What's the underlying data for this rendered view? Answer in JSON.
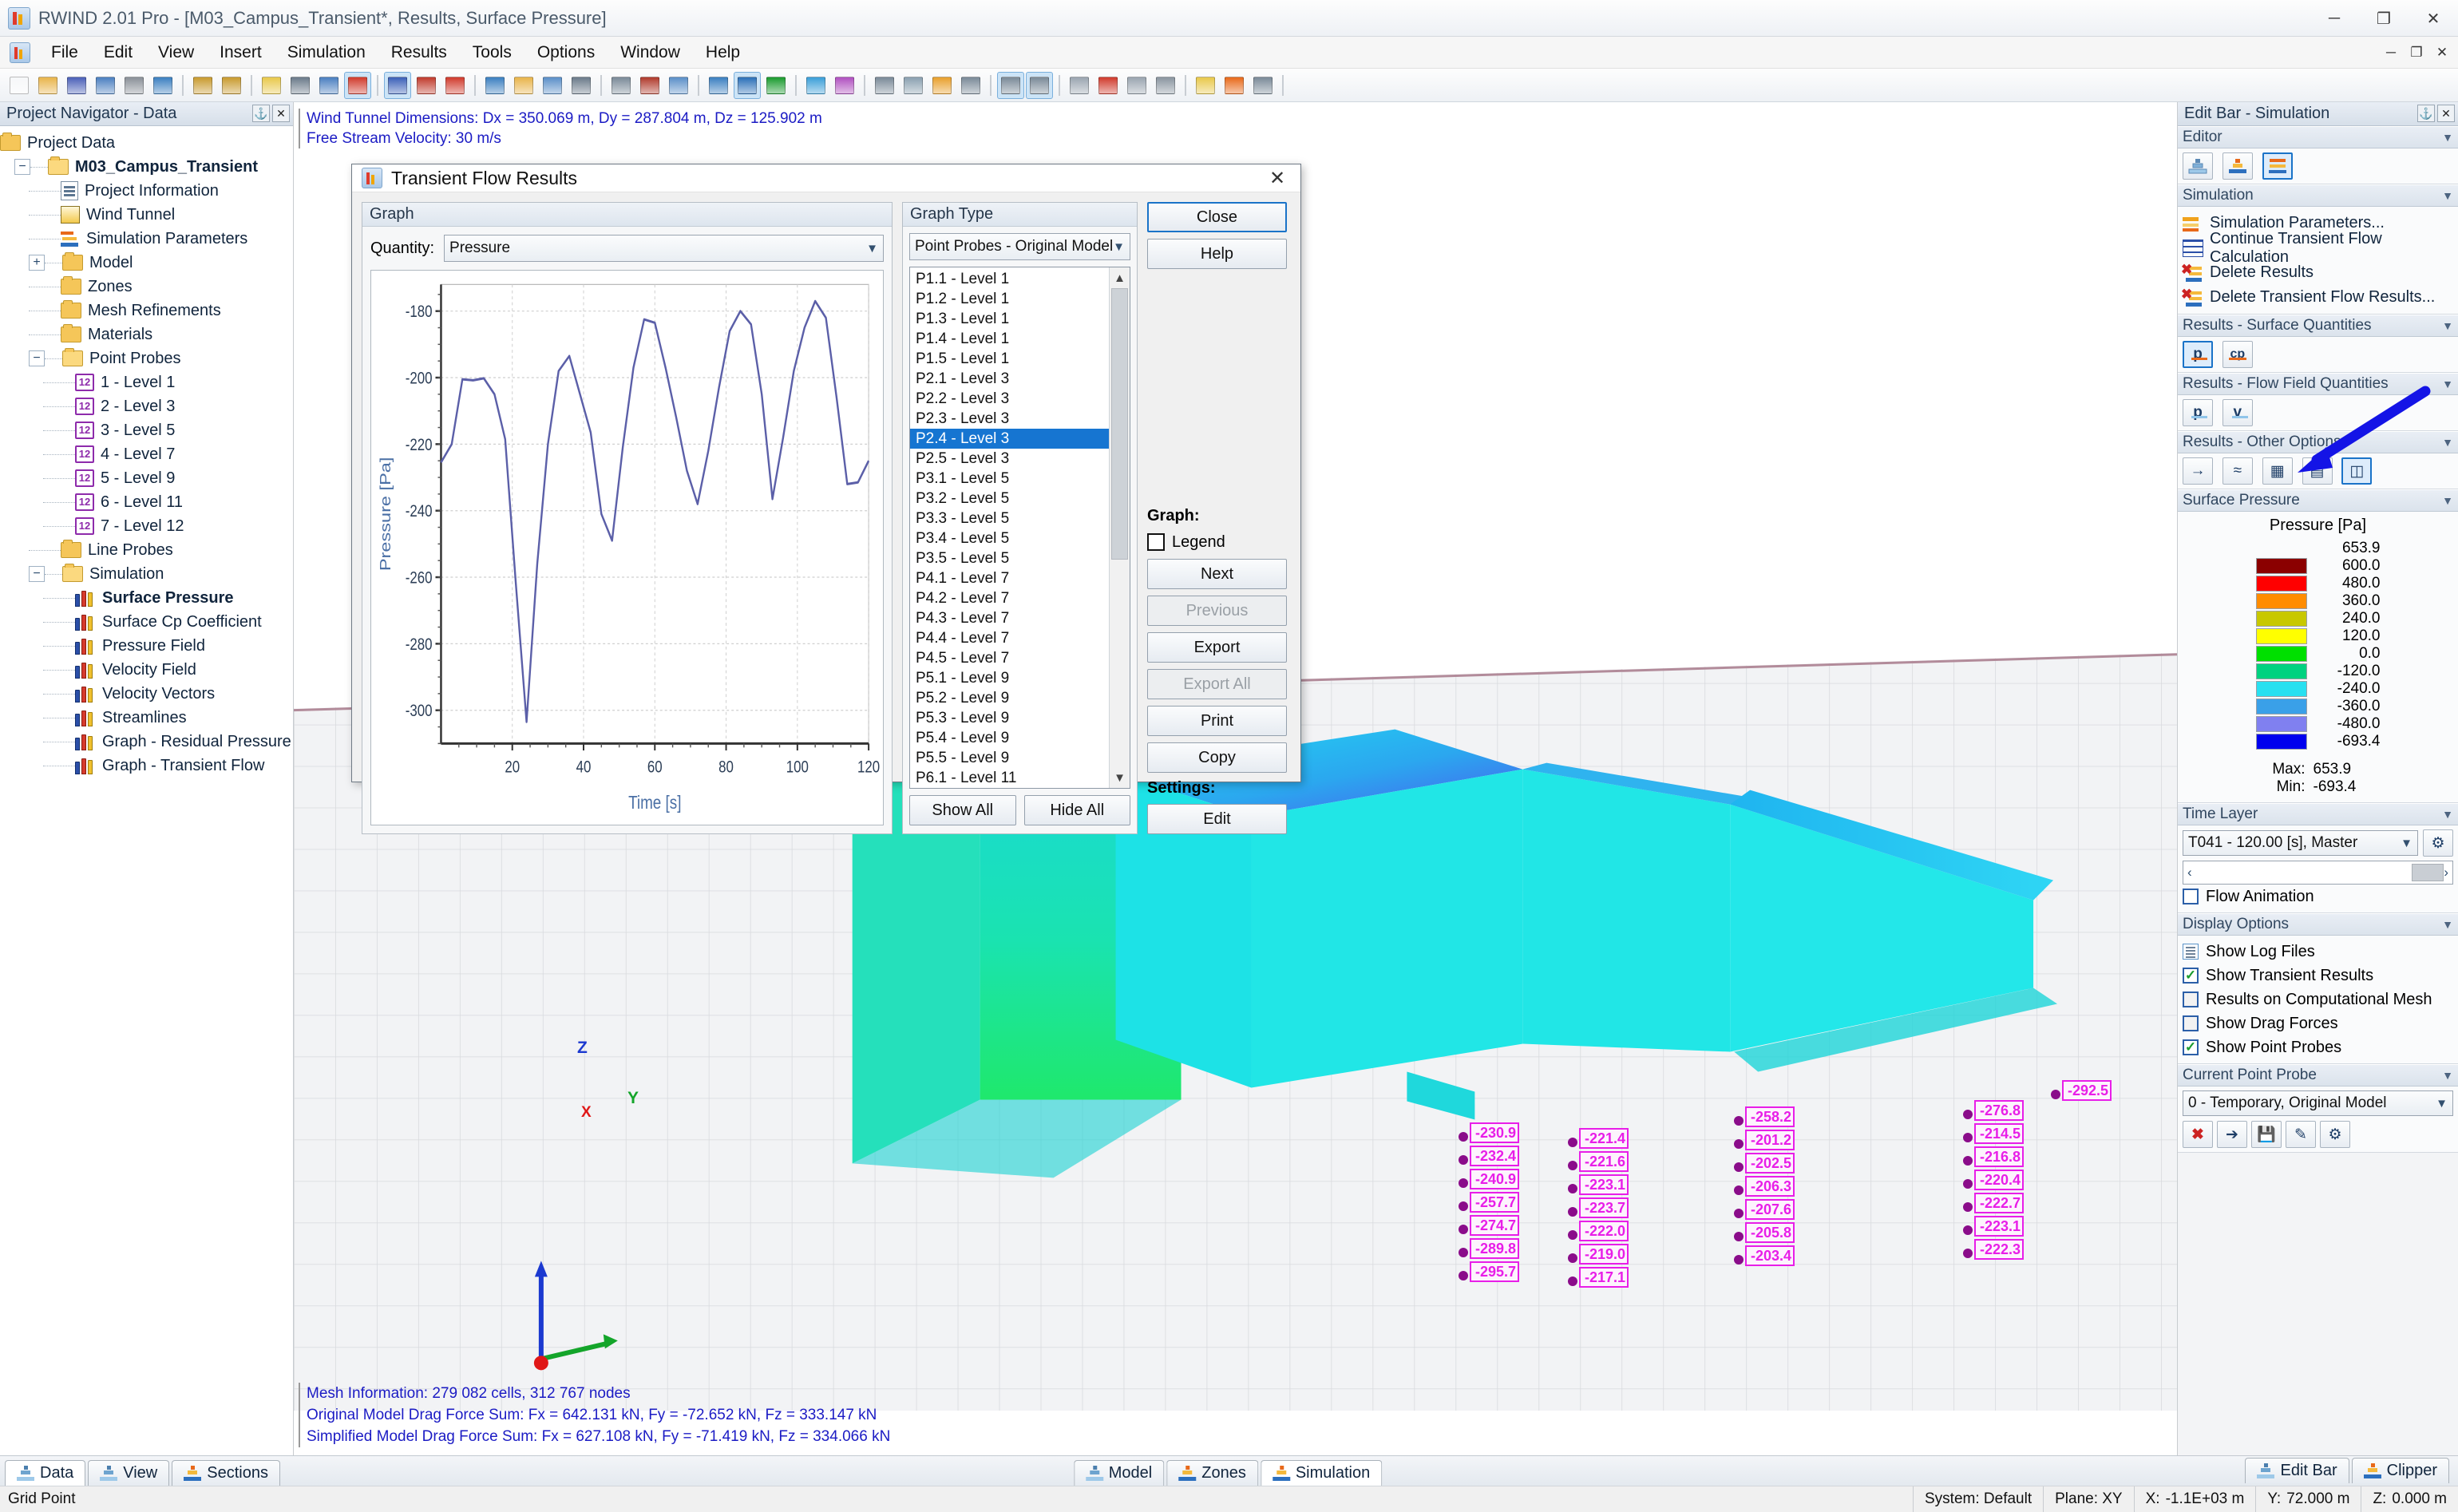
{
  "window": {
    "title": "RWIND 2.01 Pro - [M03_Campus_Transient*, Results, Surface Pressure]",
    "minimize": "─",
    "maximize": "❐",
    "close": "✕"
  },
  "menu": {
    "items": [
      "File",
      "Edit",
      "View",
      "Insert",
      "Simulation",
      "Results",
      "Tools",
      "Options",
      "Window",
      "Help"
    ],
    "mdi": [
      "─",
      "❐",
      "✕"
    ]
  },
  "navigator": {
    "title": "Project Navigator - Data",
    "pin": "⚓",
    "close": "✕",
    "items": [
      {
        "label": "Project Data",
        "icon": "folder-icon",
        "depth": 0,
        "expander": "",
        "bold": false
      },
      {
        "label": "M03_Campus_Transient",
        "icon": "folder-open-icon",
        "depth": 1,
        "expander": "−",
        "bold": true
      },
      {
        "label": "Project Information",
        "icon": "document-icon",
        "depth": 2,
        "expander": "",
        "bold": false
      },
      {
        "label": "Wind Tunnel",
        "icon": "cube-icon",
        "depth": 2,
        "expander": "",
        "bold": false
      },
      {
        "label": "Simulation Parameters",
        "icon": "simulation-parameters-icon",
        "depth": 2,
        "expander": "",
        "bold": false
      },
      {
        "label": "Model",
        "icon": "folder-icon",
        "depth": 2,
        "expander": "+",
        "bold": false
      },
      {
        "label": "Zones",
        "icon": "folder-icon",
        "depth": 2,
        "expander": "",
        "bold": false
      },
      {
        "label": "Mesh Refinements",
        "icon": "folder-icon",
        "depth": 2,
        "expander": "",
        "bold": false
      },
      {
        "label": "Materials",
        "icon": "folder-icon",
        "depth": 2,
        "expander": "",
        "bold": false
      },
      {
        "label": "Point Probes",
        "icon": "folder-open-icon",
        "depth": 2,
        "expander": "−",
        "bold": false
      },
      {
        "label": "1 - Level 1",
        "icon": "point-probe-icon",
        "depth": 3,
        "expander": "",
        "bold": false
      },
      {
        "label": "2 - Level 3",
        "icon": "point-probe-icon",
        "depth": 3,
        "expander": "",
        "bold": false
      },
      {
        "label": "3 - Level 5",
        "icon": "point-probe-icon",
        "depth": 3,
        "expander": "",
        "bold": false
      },
      {
        "label": "4 - Level 7",
        "icon": "point-probe-icon",
        "depth": 3,
        "expander": "",
        "bold": false
      },
      {
        "label": "5 - Level 9",
        "icon": "point-probe-icon",
        "depth": 3,
        "expander": "",
        "bold": false
      },
      {
        "label": "6 - Level 11",
        "icon": "point-probe-icon",
        "depth": 3,
        "expander": "",
        "bold": false
      },
      {
        "label": "7 - Level 12",
        "icon": "point-probe-icon",
        "depth": 3,
        "expander": "",
        "bold": false
      },
      {
        "label": "Line Probes",
        "icon": "folder-icon",
        "depth": 2,
        "expander": "",
        "bold": false
      },
      {
        "label": "Simulation",
        "icon": "folder-open-icon",
        "depth": 2,
        "expander": "−",
        "bold": false
      },
      {
        "label": "Surface Pressure",
        "icon": "chart-bars-icon",
        "depth": 3,
        "expander": "",
        "bold": true
      },
      {
        "label": "Surface Cp Coefficient",
        "icon": "chart-bars-icon",
        "depth": 3,
        "expander": "",
        "bold": false
      },
      {
        "label": "Pressure Field",
        "icon": "chart-bars-icon",
        "depth": 3,
        "expander": "",
        "bold": false
      },
      {
        "label": "Velocity Field",
        "icon": "chart-bars-icon",
        "depth": 3,
        "expander": "",
        "bold": false
      },
      {
        "label": "Velocity Vectors",
        "icon": "chart-bars-icon",
        "depth": 3,
        "expander": "",
        "bold": false
      },
      {
        "label": "Streamlines",
        "icon": "chart-bars-icon",
        "depth": 3,
        "expander": "",
        "bold": false
      },
      {
        "label": "Graph - Residual Pressure",
        "icon": "chart-bars-icon",
        "depth": 3,
        "expander": "",
        "bold": false
      },
      {
        "label": "Graph - Transient Flow",
        "icon": "chart-bars-icon",
        "depth": 3,
        "expander": "",
        "bold": false
      }
    ]
  },
  "viewport": {
    "info_line1": "Wind Tunnel Dimensions: Dx = 350.069 m, Dy = 287.804 m, Dz = 125.902 m",
    "info_line2": "Free Stream Velocity: 30 m/s",
    "mesh_info": "Mesh Information: 279 082 cells, 312 767 nodes",
    "drag_original": "Original Model Drag Force Sum: Fx = 642.131 kN, Fy = -72.652 kN, Fz = 333.147 kN",
    "drag_simplified": "Simplified Model Drag Force Sum: Fx = 627.108 kN, Fy = -71.419 kN, Fz = 334.066 kN",
    "axis_z": "Z",
    "axis_y": "Y",
    "axis_x": "X",
    "probe_columns": [
      {
        "values": [
          "-230.9",
          "-232.4",
          "-240.9",
          "-257.7",
          "-274.7",
          "-289.8",
          "-295.7"
        ]
      },
      {
        "values": [
          "-221.4",
          "-221.6",
          "-223.1",
          "-223.7",
          "-222.0",
          "-219.0",
          "-217.1"
        ]
      },
      {
        "values": [
          "-258.2",
          "-201.2",
          "-202.5",
          "-206.3",
          "-207.6",
          "-205.8",
          "-203.4"
        ]
      },
      {
        "values": [
          "-276.8",
          "-214.5",
          "-216.8",
          "-220.4",
          "-222.7",
          "-223.1",
          "-222.3"
        ]
      },
      {
        "values": [
          "-292.5"
        ]
      }
    ]
  },
  "dialog": {
    "title": "Transient Flow Results",
    "close_icon": "✕",
    "graph_group": "Graph",
    "quantity_label": "Quantity:",
    "quantity_value": "Pressure",
    "graph_type_group": "Graph Type",
    "graph_type_value": "Point Probes - Original Model",
    "probe_list": [
      "P1.1 - Level 1",
      "P1.2 - Level 1",
      "P1.3 - Level 1",
      "P1.4 - Level 1",
      "P1.5 - Level 1",
      "P2.1 - Level 3",
      "P2.2 - Level 3",
      "P2.3 - Level 3",
      "P2.4 - Level 3",
      "P2.5 - Level 3",
      "P3.1 - Level 5",
      "P3.2 - Level 5",
      "P3.3 - Level 5",
      "P3.4 - Level 5",
      "P3.5 - Level 5",
      "P4.1 - Level 7",
      "P4.2 - Level 7",
      "P4.3 - Level 7",
      "P4.4 - Level 7",
      "P4.5 - Level 7",
      "P5.1 - Level 9",
      "P5.2 - Level 9",
      "P5.3 - Level 9",
      "P5.4 - Level 9",
      "P5.5 - Level 9",
      "P6.1 - Level 11"
    ],
    "selected_probe": "P2.4 - Level 3",
    "show_all": "Show All",
    "hide_all": "Hide All",
    "close_button": "Close",
    "help_button": "Help",
    "graph_label": "Graph:",
    "legend_checkbox": "Legend",
    "next": "Next",
    "previous": "Previous",
    "export": "Export",
    "export_all": "Export All",
    "print": "Print",
    "copy": "Copy",
    "settings_label": "Settings:",
    "edit": "Edit"
  },
  "chart_data": {
    "type": "line",
    "title": "",
    "xlabel": "Time [s]",
    "ylabel": "Pressure [Pa]",
    "xlim": [
      0,
      120
    ],
    "ylim": [
      -310,
      -172
    ],
    "xticks": [
      20,
      40,
      60,
      80,
      100,
      120
    ],
    "yticks": [
      -180,
      -200,
      -220,
      -240,
      -260,
      -280,
      -300
    ],
    "grid": true,
    "legend": false,
    "line_color": "#5b5fa8",
    "series": [
      {
        "name": "P2.4 - Level 3",
        "x": [
          0,
          3,
          6,
          9,
          12,
          15,
          18,
          21,
          24,
          27,
          30,
          33,
          36,
          39,
          42,
          45,
          48,
          51,
          54,
          57,
          60,
          63,
          66,
          69,
          72,
          75,
          78,
          81,
          84,
          87,
          90,
          93,
          96,
          99,
          102,
          105,
          108,
          111,
          114,
          117,
          120
        ],
        "y": [
          -225.5,
          -220.0,
          -200.5,
          -200.8,
          -200.2,
          -205.0,
          -218.5,
          -262.0,
          -303.5,
          -256.0,
          -220.0,
          -198.0,
          -193.5,
          -205.0,
          -216.5,
          -241.0,
          -249.0,
          -221.0,
          -197.0,
          -182.5,
          -183.5,
          -197.0,
          -212.0,
          -228.0,
          -238.0,
          -222.0,
          -203.0,
          -186.0,
          -180.0,
          -184.0,
          -205.0,
          -236.5,
          -218.0,
          -198.0,
          -185.0,
          -177.0,
          -182.0,
          -206.0,
          -232.0,
          -231.5,
          -225.0
        ]
      }
    ]
  },
  "editbar": {
    "title": "Edit Bar - Simulation",
    "pin": "⚓",
    "close": "✕",
    "sections": {
      "editor": {
        "title": "Editor",
        "buttons": [
          "model-editor-icon",
          "zones-editor-icon",
          "simulation-editor-icon"
        ]
      },
      "simulation": {
        "title": "Simulation",
        "items": [
          {
            "label": "Simulation Parameters...",
            "icon": "simulation-parameters-icon"
          },
          {
            "label": "Continue Transient Flow Calculation",
            "icon": "transient-calc-icon"
          },
          {
            "label": "Delete Results",
            "icon": "delete-results-icon"
          },
          {
            "label": "Delete Transient Flow Results...",
            "icon": "delete-transient-icon"
          }
        ]
      },
      "surface_quantities": {
        "title": "Results - Surface Quantities",
        "buttons": [
          "p",
          "cp"
        ]
      },
      "flow_field": {
        "title": "Results - Flow Field Quantities",
        "buttons": [
          "p",
          "v"
        ]
      },
      "other_options": {
        "title": "Results - Other Options",
        "buttons": [
          "streamlines-icon",
          "flow-layers-icon",
          "section-icon",
          "graph-icon",
          "results-table-icon"
        ]
      },
      "surface_pressure": {
        "title": "Surface Pressure",
        "legend_title": "Pressure [Pa]",
        "scale": [
          {
            "color": "#8b0000",
            "value": "653.9"
          },
          {
            "color": "#ff0000",
            "value": "600.0"
          },
          {
            "color": "#ff8c00",
            "value": "480.0"
          },
          {
            "color": "#c8c800",
            "value": "360.0"
          },
          {
            "color": "#ffff00",
            "value": "240.0"
          },
          {
            "color": "#00e000",
            "value": "120.0"
          },
          {
            "color": "#00d280",
            "value": "0.0"
          },
          {
            "color": "#28e0f0",
            "value": "-120.0"
          },
          {
            "color": "#3aa0e8",
            "value": "-240.0"
          },
          {
            "color": "#8080f0",
            "value": "-360.0"
          },
          {
            "color": "#0000ee",
            "value": "-480.0"
          }
        ],
        "last_value": "-693.4",
        "max_label": "Max:",
        "max_value": "653.9",
        "min_label": "Min:",
        "min_value": "-693.4"
      },
      "time_layer": {
        "title": "Time Layer",
        "value": "T041 - 120.00 [s], Master",
        "settings_icon": "gear-icon",
        "prev_arrow": "‹",
        "next_arrow": "›",
        "flow_animation": "Flow Animation",
        "flow_animation_checked": false
      },
      "display_options": {
        "title": "Display Options",
        "items": [
          {
            "label": "Show Log Files",
            "type": "doc",
            "checked": false
          },
          {
            "label": "Show Transient Results",
            "type": "check",
            "checked": true
          },
          {
            "label": "Results on Computational Mesh",
            "type": "check",
            "checked": false
          },
          {
            "label": "Show Drag Forces",
            "type": "check",
            "checked": false
          },
          {
            "label": "Show Point Probes",
            "type": "check",
            "checked": true
          }
        ]
      },
      "current_point_probe": {
        "title": "Current Point Probe",
        "value": "0 - Temporary, Original Model",
        "buttons": [
          "delete-probe-icon",
          "pick-probe-icon",
          "save-probe-icon",
          "edit-probe-icon",
          "settings-probe-icon"
        ]
      }
    }
  },
  "bottom_tabs": {
    "left": [
      {
        "label": "Data",
        "icon": "data-icon",
        "active": true
      },
      {
        "label": "View",
        "icon": "view-icon",
        "active": false
      },
      {
        "label": "Sections",
        "icon": "sections-icon",
        "active": false
      }
    ],
    "center": [
      {
        "label": "Model",
        "icon": "model-icon",
        "active": false
      },
      {
        "label": "Zones",
        "icon": "zones-icon",
        "active": false
      },
      {
        "label": "Simulation",
        "icon": "simulation-icon",
        "active": true
      }
    ],
    "right": [
      {
        "label": "Edit Bar",
        "icon": "editbar-icon",
        "active": false
      },
      {
        "label": "Clipper",
        "icon": "clipper-icon",
        "active": false
      }
    ]
  },
  "statusbar": {
    "left": "Grid Point",
    "system": "System: Default",
    "plane": "Plane: XY",
    "x_label": "X:",
    "x_value": "-1.1E+03 m",
    "y_label": "Y:",
    "y_value": "72.000 m",
    "z_label": "Z:",
    "z_value": "0.000 m"
  }
}
